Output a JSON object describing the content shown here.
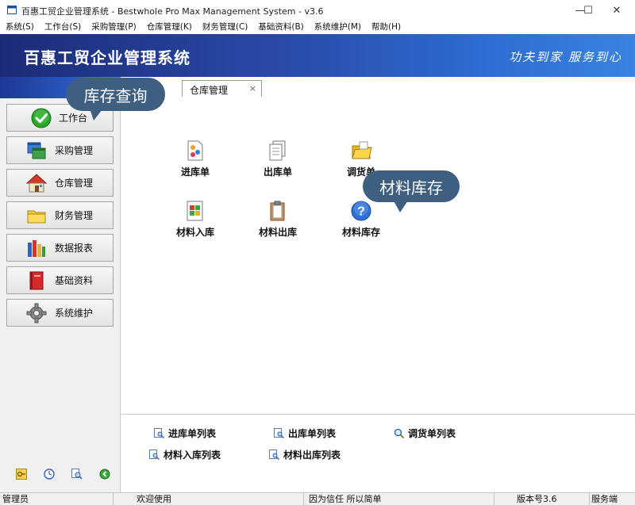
{
  "window": {
    "title": "百惠工贸企业管理系统 - Bestwhole Pro Max Management System - v3.6",
    "minimize": "—",
    "maximize": "☐",
    "close": "✕"
  },
  "menu": [
    "系统(S)",
    "工作台(S)",
    "采购管理(P)",
    "仓库管理(K)",
    "财务管理(C)",
    "基础资料(B)",
    "系统维护(M)",
    "帮助(H)"
  ],
  "banner": {
    "brand": "百惠工贸企业管理系统",
    "slogan": "功夫到家 服务到心"
  },
  "tab": {
    "label": "仓库管理",
    "close": "×"
  },
  "sidebar": {
    "items": [
      {
        "label": "工作台",
        "icon": "check-circle-icon"
      },
      {
        "label": "采购管理",
        "icon": "windows-icon"
      },
      {
        "label": "仓库管理",
        "icon": "house-icon"
      },
      {
        "label": "财务管理",
        "icon": "folder-icon"
      },
      {
        "label": "数据报表",
        "icon": "books-icon"
      },
      {
        "label": "基础资料",
        "icon": "red-book-icon"
      },
      {
        "label": "系统维护",
        "icon": "gear-icon"
      }
    ]
  },
  "main": {
    "grid": [
      {
        "label": "进库单",
        "icon": "document-colors-icon"
      },
      {
        "label": "出库单",
        "icon": "documents-icon"
      },
      {
        "label": "调货单",
        "icon": "folder-yellow-icon"
      },
      {
        "label": "材料入库",
        "icon": "document-blocks-icon"
      },
      {
        "label": "材料出库",
        "icon": "clipboard-icon"
      },
      {
        "label": "材料库存",
        "icon": "help-icon"
      }
    ],
    "lists": [
      {
        "label": "进库单列表"
      },
      {
        "label": "出库单列表"
      },
      {
        "label": "调货单列表"
      },
      {
        "label": "材料入库列表"
      },
      {
        "label": "材料出库列表"
      }
    ]
  },
  "callouts": {
    "left": "库存查询",
    "right": "材料库存"
  },
  "statusbar": {
    "user": "管理员",
    "welcome": "欢迎使用",
    "motto": "因为信任 所以简单",
    "version": "版本号3.6",
    "mode": "服务端"
  },
  "colors": {
    "banner_start": "#1c2b78",
    "banner_end": "#3a83e0",
    "callout": "#3e5f80"
  }
}
